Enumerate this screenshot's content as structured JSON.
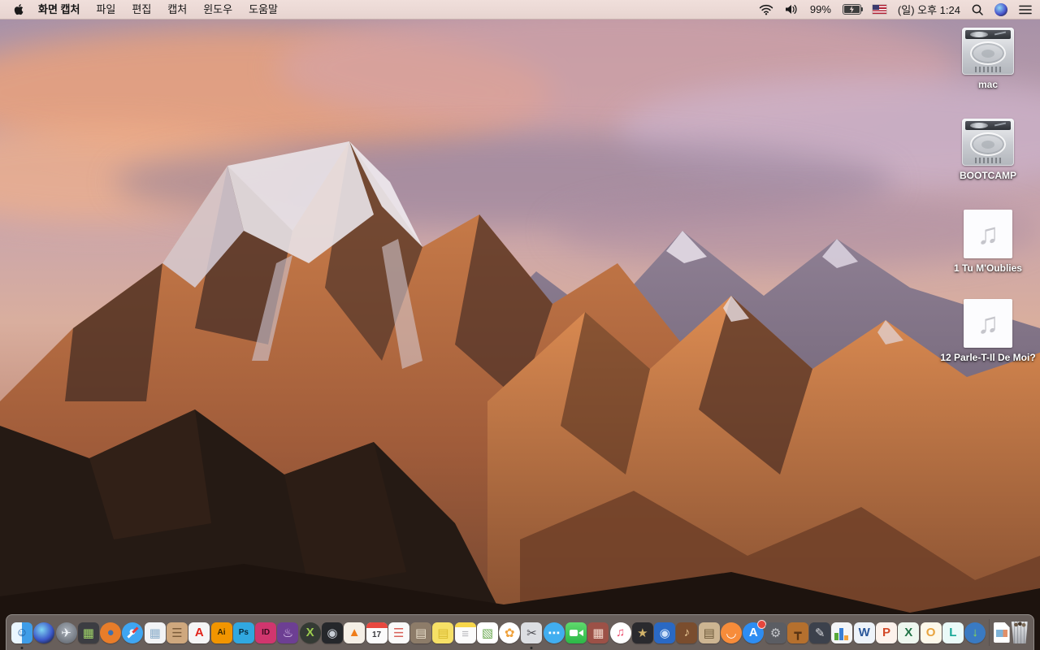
{
  "menu_bar": {
    "app_menus": [
      "화면 캡처",
      "파일",
      "편집",
      "캡처",
      "윈도우",
      "도움말"
    ],
    "status": {
      "battery_percent": "99%",
      "battery_charging": true,
      "clock": "(일) 오후 1:24",
      "input_source": "US"
    }
  },
  "desktop": {
    "audio_glyph": "♫",
    "icons": [
      {
        "kind": "drive",
        "label": "mac"
      },
      {
        "kind": "drive",
        "label": "BOOTCAMP"
      },
      {
        "kind": "audio",
        "label": "1 Tu M'Oublies"
      },
      {
        "kind": "audio",
        "label": "12 Parle-T-Il De Moi?"
      }
    ]
  },
  "dock": {
    "trash_full": true,
    "items": [
      {
        "name": "finder",
        "glyph": "☺",
        "fg": "#1c5a9c",
        "style": "finder",
        "running": true
      },
      {
        "name": "siri",
        "glyph": "",
        "style": "siri",
        "circle": true
      },
      {
        "name": "launchpad",
        "glyph": "✈",
        "fg": "#eef2f6",
        "style": "launchpad",
        "circle": true
      },
      {
        "name": "mission-control",
        "glyph": "▦",
        "bg": "#3c3d42",
        "fg": "#9fd468"
      },
      {
        "name": "firefox",
        "glyph": "●",
        "bg": "#e87d2a",
        "fg": "#3d6fb0",
        "circle": true
      },
      {
        "name": "safari",
        "glyph": "",
        "style": "safari",
        "circle": true
      },
      {
        "name": "preview",
        "glyph": "▦",
        "bg": "#f2f3f5",
        "fg": "#8fb0cc"
      },
      {
        "name": "contacts",
        "glyph": "☰",
        "bg": "#cfa87e",
        "fg": "#7c5c3a"
      },
      {
        "name": "acrobat-reader",
        "glyph": "A",
        "bg": "#f5f5f5",
        "fg": "#e2231a"
      },
      {
        "name": "illustrator",
        "glyph": "Ai",
        "bg": "#f29500",
        "fg": "#3a2800"
      },
      {
        "name": "photoshop",
        "glyph": "Ps",
        "bg": "#31a8e0",
        "fg": "#082a3c"
      },
      {
        "name": "indesign",
        "glyph": "ID",
        "bg": "#d0366e",
        "fg": "#3c0a1e"
      },
      {
        "name": "toast-titanium",
        "glyph": "♨",
        "bg": "#6d3f93",
        "fg": "#e9d4fa"
      },
      {
        "name": "video-converter",
        "glyph": "X",
        "bg": "#343a34",
        "fg": "#9ccc4e",
        "circle": true
      },
      {
        "name": "drive-utility",
        "glyph": "◉",
        "bg": "#25272b",
        "fg": "#c9ced6"
      },
      {
        "name": "vlc",
        "glyph": "▲",
        "bg": "#f5efe6",
        "fg": "#ef7d1a"
      },
      {
        "name": "calendar",
        "glyph": "17",
        "fg": "#38383c",
        "style": "calendar"
      },
      {
        "name": "reminders",
        "glyph": "☰",
        "bg": "#fafafa",
        "fg": "#d86058"
      },
      {
        "name": "stuffit-expander",
        "glyph": "▤",
        "bg": "#8d7c69",
        "fg": "#e7ddc9"
      },
      {
        "name": "stickies",
        "glyph": "▤",
        "bg": "#f6e066",
        "fg": "#d8b92e"
      },
      {
        "name": "notes",
        "glyph": "≡",
        "fg": "#b9b9bd",
        "style": "notes"
      },
      {
        "name": "web-document",
        "glyph": "▧",
        "bg": "#ffffff",
        "fg": "#6aa84f"
      },
      {
        "name": "photos",
        "glyph": "✿",
        "bg": "#ffffff",
        "fg": "#f0a23c",
        "circle": true
      },
      {
        "name": "grab",
        "glyph": "✂",
        "bg": "#dcdee2",
        "fg": "#4c4c52",
        "running": true
      },
      {
        "name": "messages",
        "glyph": "⋯",
        "bg": "#41aef0",
        "fg": "#ffffff",
        "circle": true
      },
      {
        "name": "facetime",
        "glyph": "",
        "style": "facetime"
      },
      {
        "name": "photo-booth",
        "glyph": "▦",
        "bg": "#9c5147",
        "fg": "#f2d8cc"
      },
      {
        "name": "itunes",
        "glyph": "♫",
        "bg": "#ffffff",
        "fg": "#ec4f6e",
        "circle": true
      },
      {
        "name": "imovie",
        "glyph": "★",
        "bg": "#2a2a2e",
        "fg": "#d2b36a"
      },
      {
        "name": "dvd-player-app",
        "glyph": "◉",
        "bg": "#2a69c4",
        "fg": "#cfe2fa"
      },
      {
        "name": "garageband",
        "glyph": "♪",
        "bg": "#7a4d2e",
        "fg": "#f0cf9a"
      },
      {
        "name": "publishing-app",
        "glyph": "▤",
        "bg": "#cdb592",
        "fg": "#6e5a3a"
      },
      {
        "name": "ibooks",
        "glyph": "◡",
        "bg": "#f78c3a",
        "fg": "#ffffff",
        "circle": true
      },
      {
        "name": "app-store",
        "glyph": "A",
        "bg": "#2e8df2",
        "fg": "#ffffff",
        "circle": true,
        "badge": true
      },
      {
        "name": "system-preferences",
        "glyph": "⚙",
        "bg": "#5b5d63",
        "fg": "#c6c8cc"
      },
      {
        "name": "keynote",
        "glyph": "┳",
        "bg": "#b5702e",
        "fg": "#5a3413"
      },
      {
        "name": "pages",
        "glyph": "✎",
        "bg": "#3c414c",
        "fg": "#d9dade"
      },
      {
        "name": "numbers",
        "glyph": "",
        "style": "numbers"
      },
      {
        "name": "word",
        "glyph": "W",
        "bg": "#eef3fa",
        "fg": "#2b579a"
      },
      {
        "name": "powerpoint",
        "glyph": "P",
        "bg": "#fdf2ec",
        "fg": "#d24726"
      },
      {
        "name": "excel",
        "glyph": "X",
        "bg": "#eef7ef",
        "fg": "#217346"
      },
      {
        "name": "outlook",
        "glyph": "O",
        "bg": "#fdf8ea",
        "fg": "#e8a33d"
      },
      {
        "name": "lync",
        "glyph": "L",
        "bg": "#eafaf8",
        "fg": "#16a797"
      },
      {
        "name": "download-manager",
        "glyph": "↓",
        "bg": "#3a7ac2",
        "fg": "#8fe04a",
        "circle": true
      },
      {
        "divider": true
      },
      {
        "name": "jpeg-file",
        "glyph": "",
        "style": "file"
      },
      {
        "name": "trash",
        "glyph": "",
        "style": "trash"
      }
    ]
  }
}
